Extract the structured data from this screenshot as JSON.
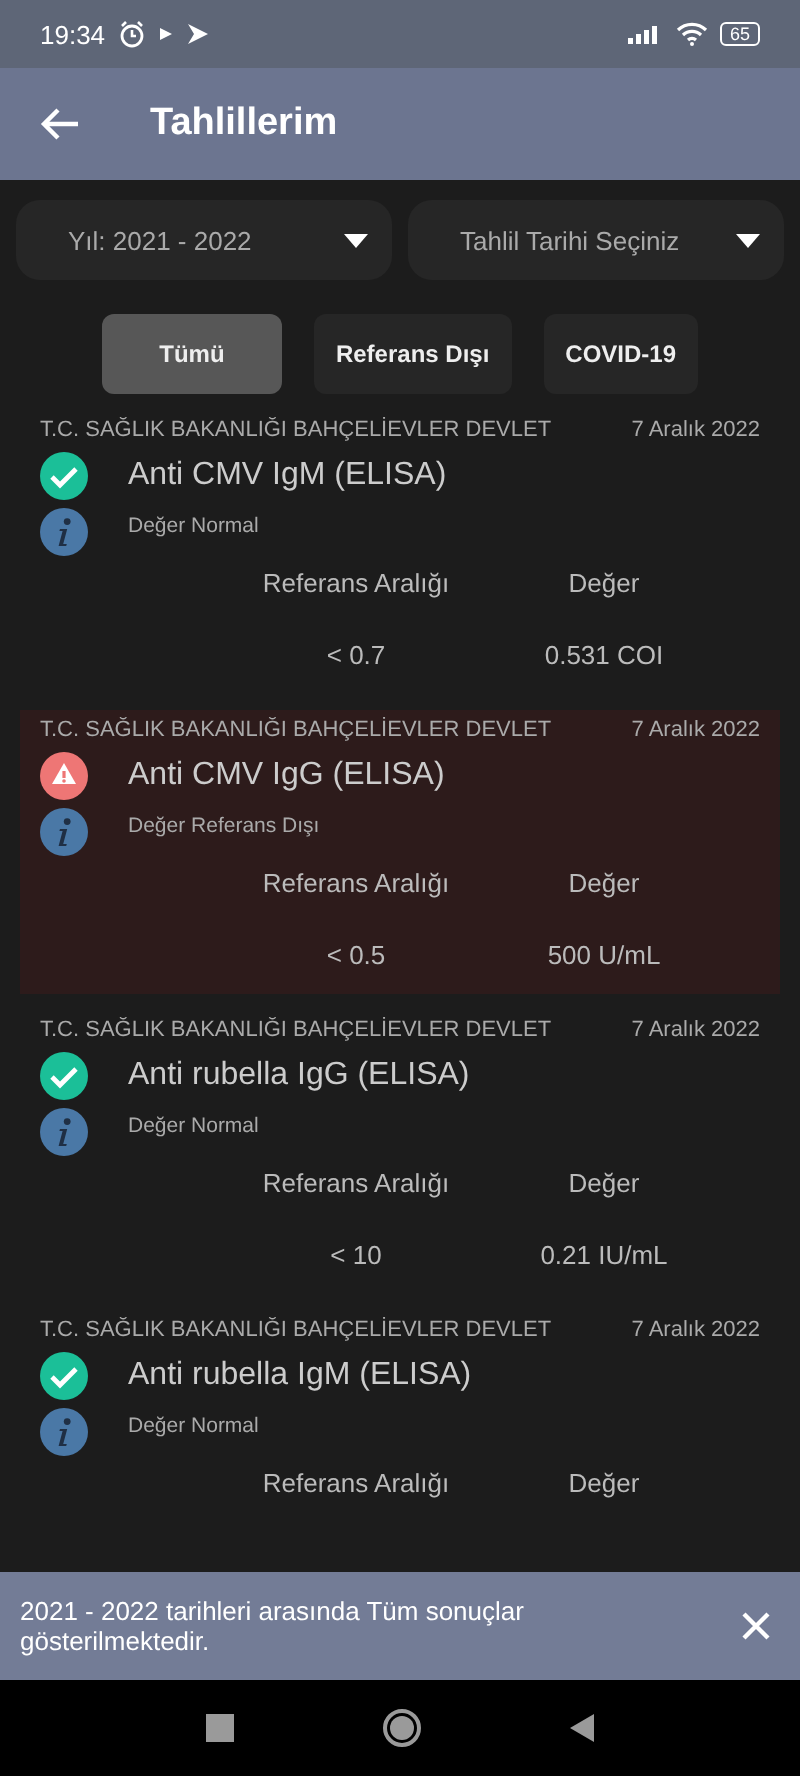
{
  "status_bar": {
    "time": "19:34",
    "battery": "65"
  },
  "app_bar": {
    "title": "Tahlillerim"
  },
  "filters": [
    {
      "value": "Yıl: 2021 - 2022"
    },
    {
      "value": "Tahlil Tarihi Seçiniz"
    }
  ],
  "tabs": [
    {
      "label": "Tümü",
      "selected": true
    },
    {
      "label": "Referans Dışı",
      "selected": false
    },
    {
      "label": "COVID-19",
      "selected": false
    }
  ],
  "results": [
    {
      "hospital": "T.C. SAĞLIK BAKANLIĞI BAHÇELİEVLER DEVLET",
      "date": "7 Aralık 2022",
      "test": "Anti CMV IgM (ELISA)",
      "kind": "normal",
      "status_text": "Değer Normal",
      "range_label": "Referans Aralığı",
      "value_label": "Değer",
      "range": "< 0.7",
      "value": "0.531 COI"
    },
    {
      "hospital": "T.C. SAĞLIK BAKANLIĞI BAHÇELİEVLER DEVLET",
      "date": "7 Aralık 2022",
      "test": "Anti CMV IgG (ELISA)",
      "kind": "abnormal",
      "status_text": "Değer Referans Dışı",
      "range_label": "Referans Aralığı",
      "value_label": "Değer",
      "range": "< 0.5",
      "value": "500 U/mL"
    },
    {
      "hospital": "T.C. SAĞLIK BAKANLIĞI BAHÇELİEVLER DEVLET",
      "date": "7 Aralık 2022",
      "test": "Anti rubella IgG (ELISA)",
      "kind": "normal",
      "status_text": "Değer Normal",
      "range_label": "Referans Aralığı",
      "value_label": "Değer",
      "range": "< 10",
      "value": "0.21 IU/mL"
    },
    {
      "hospital": "T.C. SAĞLIK BAKANLIĞI BAHÇELİEVLER DEVLET",
      "date": "7 Aralık 2022",
      "test": "Anti rubella IgM (ELISA)",
      "kind": "normal",
      "status_text": "Değer Normal",
      "range_label": "Referans Aralığı",
      "value_label": "Değer"
    }
  ],
  "snackbar": {
    "message": "2021 - 2022 tarihleri arasında Tüm sonuçlar gösterilmektedir."
  }
}
